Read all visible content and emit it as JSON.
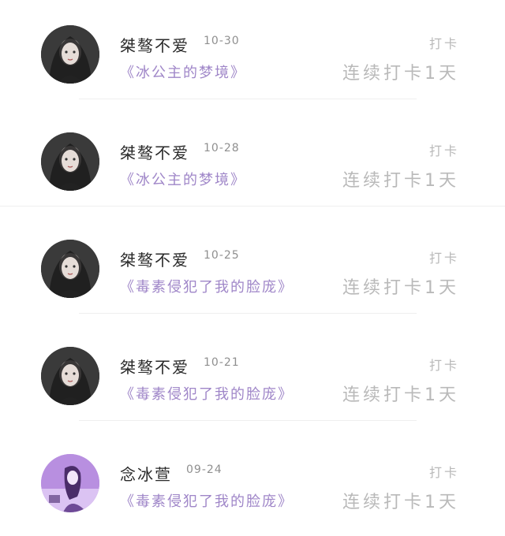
{
  "entries": [
    {
      "name": "桀骜不爱",
      "date": "10-30",
      "book": "《冰公主的梦境》",
      "action": "打卡",
      "streak": "连续打卡1天",
      "avatar": "avatar-gothic-girl"
    },
    {
      "name": "桀骜不爱",
      "date": "10-28",
      "book": "《冰公主的梦境》",
      "action": "打卡",
      "streak": "连续打卡1天",
      "avatar": "avatar-gothic-girl"
    },
    {
      "name": "桀骜不爱",
      "date": "10-25",
      "book": "《毒素侵犯了我的脸庞》",
      "action": "打卡",
      "streak": "连续打卡1天",
      "avatar": "avatar-gothic-girl"
    },
    {
      "name": "桀骜不爱",
      "date": "10-21",
      "book": "《毒素侵犯了我的脸庞》",
      "action": "打卡",
      "streak": "连续打卡1天",
      "avatar": "avatar-gothic-girl"
    },
    {
      "name": "念冰萱",
      "date": "09-24",
      "book": "《毒素侵犯了我的脸庞》",
      "action": "打卡",
      "streak": "连续打卡1天",
      "avatar": "avatar-purple-girl"
    }
  ],
  "colors": {
    "book_title": "#9f86c8",
    "muted": "#b9b9b9",
    "name": "#2a2a2a"
  }
}
